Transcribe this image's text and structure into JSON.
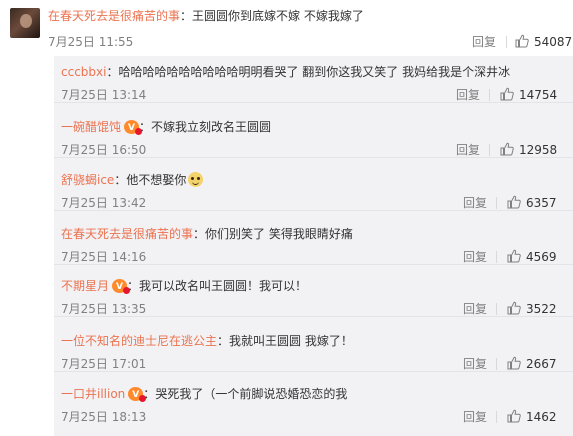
{
  "main": {
    "user": "在春天死去是很痛苦的事",
    "separator": "：",
    "text": "王圆圆你到底嫁不嫁 不嫁我嫁了",
    "time": "7月25日 11:55",
    "reply_label": "回复",
    "likes": "54087"
  },
  "replies": [
    {
      "user": "cccbbxi",
      "separator": "：",
      "text": "哈哈哈哈哈哈哈哈哈哈明明看哭了 翻到你这我又笑了 我妈给我是个深井冰",
      "time": "7月25日 13:14",
      "reply_label": "回复",
      "likes": "14754"
    },
    {
      "user": "一碗醋馄饨",
      "separator": "：",
      "text": "不嫁我立刻改名王圆圆",
      "time": "7月25日 16:50",
      "reply_label": "回复",
      "likes": "12958"
    },
    {
      "user": "舒骁蝎ice",
      "separator": "：",
      "text": "他不想娶你",
      "time": "7月25日 13:42",
      "reply_label": "回复",
      "likes": "6357"
    },
    {
      "user": "在春天死去是很痛苦的事",
      "separator": "：",
      "text": "你们别笑了 笑得我眼睛好痛",
      "time": "7月25日 14:16",
      "reply_label": "回复",
      "likes": "4569"
    },
    {
      "user": "不期星月",
      "separator": "：",
      "text": "我可以改名叫王圆圆！我可以！",
      "time": "7月25日 13:35",
      "reply_label": "回复",
      "likes": "3522"
    },
    {
      "user": "一位不知名的迪士尼在逃公主",
      "separator": "：",
      "text": "我就叫王圆圆 我嫁了！",
      "time": "7月25日 17:01",
      "reply_label": "回复",
      "likes": "2667"
    },
    {
      "user": "一口井illion",
      "separator": "：",
      "text": "哭死我了（一个前脚说恐婚恐恋的我",
      "time": "7月25日 18:13",
      "reply_label": "回复",
      "likes": "1462"
    }
  ],
  "icons": {
    "like": "thumbs-up-icon",
    "vip": "vip-badge-icon",
    "emoji": "smiley-emoji-icon"
  },
  "colors": {
    "username": "#eb7350",
    "meta": "#808080",
    "reply_bg": "#f2f2f5"
  }
}
